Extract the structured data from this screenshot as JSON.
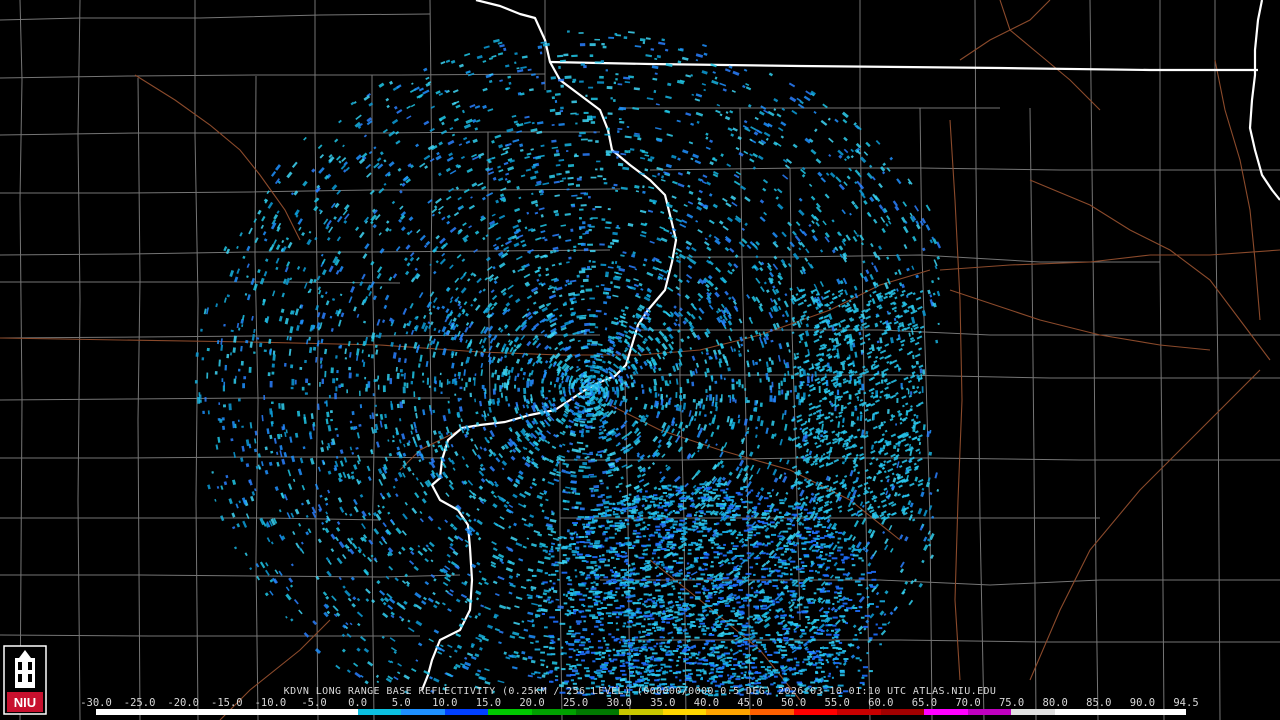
{
  "product": {
    "caption": "KDVN LONG RANGE BASE REFLECTIVITY (0.25KM / 256 LEVEL) (000000/0000 0.5 DEG) 2026-03-10 01:10 UTC   ATLAS.NIU.EDU"
  },
  "logo": {
    "text": "NIU",
    "color": "#c8102e"
  },
  "colors": {
    "background": "#000000",
    "county_lines": "#8a8a8a",
    "state_lines": "#ffffff",
    "roads": "#8b4a2b"
  },
  "legend": {
    "labels": [
      "-30.0",
      "-25.0",
      "-20.0",
      "-15.0",
      "-10.0",
      "-5.0",
      "0.0",
      "5.0",
      "10.0",
      "15.0",
      "20.0",
      "25.0",
      "30.0",
      "35.0",
      "40.0",
      "45.0",
      "50.0",
      "55.0",
      "60.0",
      "65.0",
      "70.0",
      "75.0",
      "80.0",
      "85.0",
      "90.0",
      "94.5"
    ],
    "colors": [
      "#ffffff",
      "#ffffff",
      "#ffffff",
      "#ffffff",
      "#ffffff",
      "#ffffff",
      "#0cc0e0",
      "#1e90ff",
      "#0040ff",
      "#00c800",
      "#00a000",
      "#007800",
      "#c8c800",
      "#ffd700",
      "#ffa500",
      "#ff6000",
      "#ff0000",
      "#c80000",
      "#a00000",
      "#ff00ff",
      "#c000c0",
      "#e0e0e0",
      "#ffffff",
      "#ffffff",
      "#ffffff"
    ]
  }
}
